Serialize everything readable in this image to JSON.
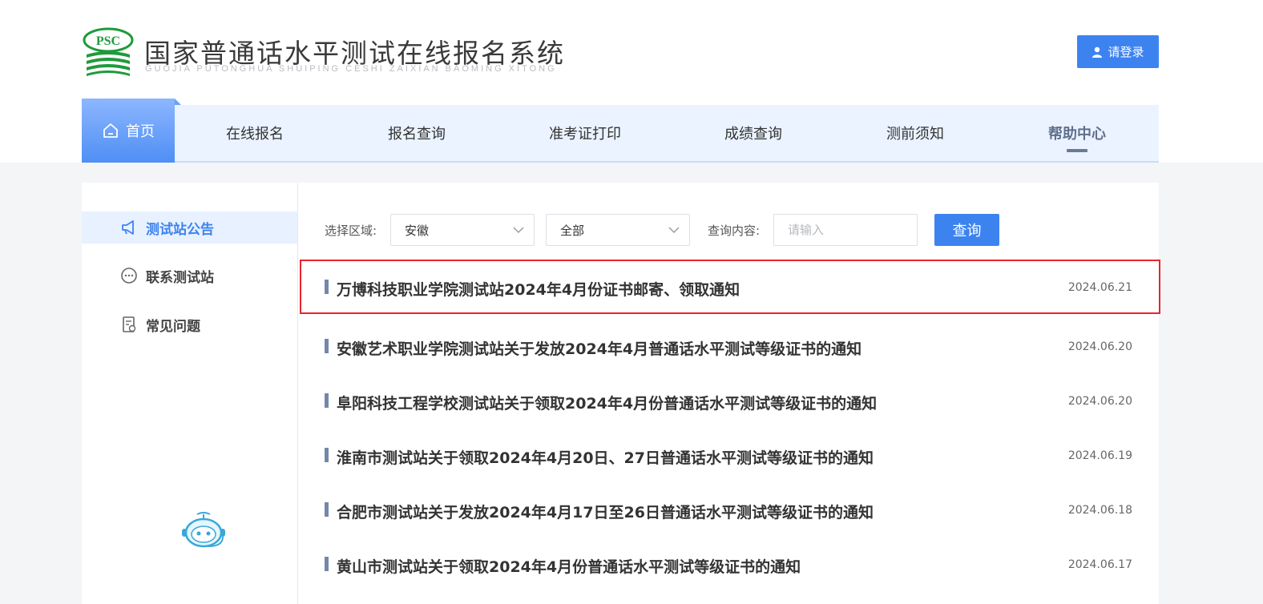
{
  "header": {
    "logo_text": "PSC",
    "title": "国家普通话水平测试在线报名系统",
    "subtitle": "GUOJIA PUTONGHUA SHUIPING CESHI ZAIXIAN BAOMING XITONG",
    "login_label": "请登录"
  },
  "nav": {
    "items": [
      {
        "label": "首页",
        "active": true
      },
      {
        "label": "在线报名"
      },
      {
        "label": "报名查询"
      },
      {
        "label": "准考证打印"
      },
      {
        "label": "成绩查询"
      },
      {
        "label": "测前须知"
      },
      {
        "label": "帮助中心",
        "current": true
      }
    ]
  },
  "sidebar": {
    "items": [
      {
        "label": "测试站公告",
        "icon": "megaphone-icon",
        "active": true
      },
      {
        "label": "联系测试站",
        "icon": "chat-bubble-icon"
      },
      {
        "label": "常见问题",
        "icon": "faq-document-icon"
      }
    ],
    "assistant_icon": "robot-assistant-icon"
  },
  "filter": {
    "region_label": "选择区域:",
    "province_value": "安徽",
    "city_value": "全部",
    "query_label": "查询内容:",
    "query_placeholder": "请输入",
    "search_label": "查询"
  },
  "notices": [
    {
      "title": "万博科技职业学院测试站2024年4月份证书邮寄、领取通知",
      "date": "2024.06.21",
      "highlighted": true
    },
    {
      "title": "安徽艺术职业学院测试站关于发放2024年4月普通话水平测试等级证书的通知",
      "date": "2024.06.20"
    },
    {
      "title": "阜阳科技工程学校测试站关于领取2024年4月份普通话水平测试等级证书的通知",
      "date": "2024.06.20"
    },
    {
      "title": "淮南市测试站关于领取2024年4月20日、27日普通话水平测试等级证书的通知",
      "date": "2024.06.19"
    },
    {
      "title": "合肥市测试站关于发放2024年4月17日至26日普通话水平测试等级证书的通知",
      "date": "2024.06.18"
    },
    {
      "title": "黄山市测试站关于领取2024年4月份普通话水平测试等级证书的通知",
      "date": "2024.06.17"
    }
  ],
  "colors": {
    "primary": "#3d83f0",
    "highlight_border": "#e8262c",
    "nav_bg": "#eaf3ff",
    "logo_green": "#1f9a3c"
  }
}
